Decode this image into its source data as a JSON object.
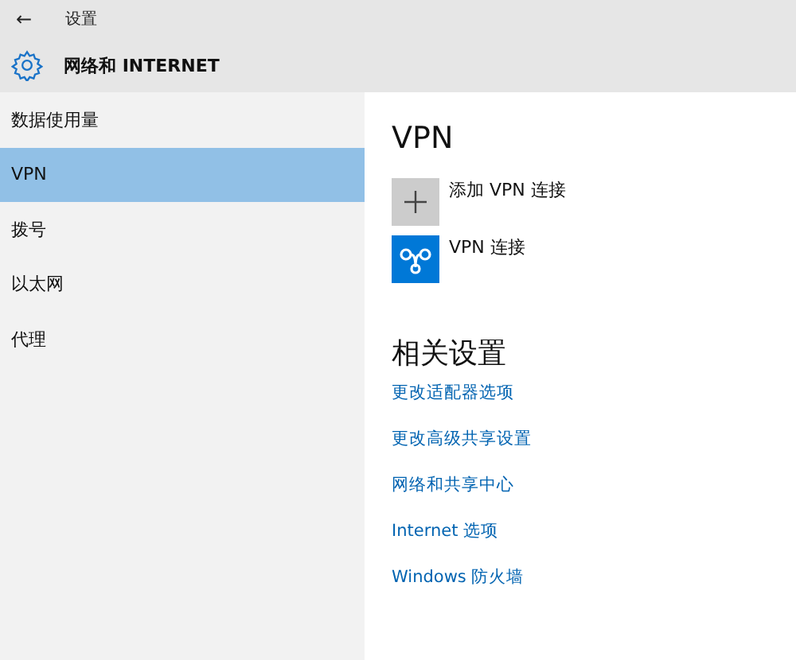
{
  "title_bar": {
    "back": "←",
    "title": "设置"
  },
  "header": {
    "title": "网络和 INTERNET"
  },
  "sidebar": {
    "items": [
      {
        "label": "数据使用量",
        "selected": false
      },
      {
        "label": "VPN",
        "selected": true
      },
      {
        "label": "拨号",
        "selected": false
      },
      {
        "label": "以太网",
        "selected": false
      },
      {
        "label": "代理",
        "selected": false
      }
    ]
  },
  "content": {
    "heading": "VPN",
    "items": [
      {
        "kind": "add",
        "label": "添加 VPN 连接"
      },
      {
        "kind": "vpn",
        "label": "VPN 连接"
      }
    ],
    "related_heading": "相关设置",
    "links": [
      "更改适配器选项",
      "更改高级共享设置",
      "网络和共享中心",
      "Internet 选项",
      "Windows 防火墙"
    ]
  }
}
